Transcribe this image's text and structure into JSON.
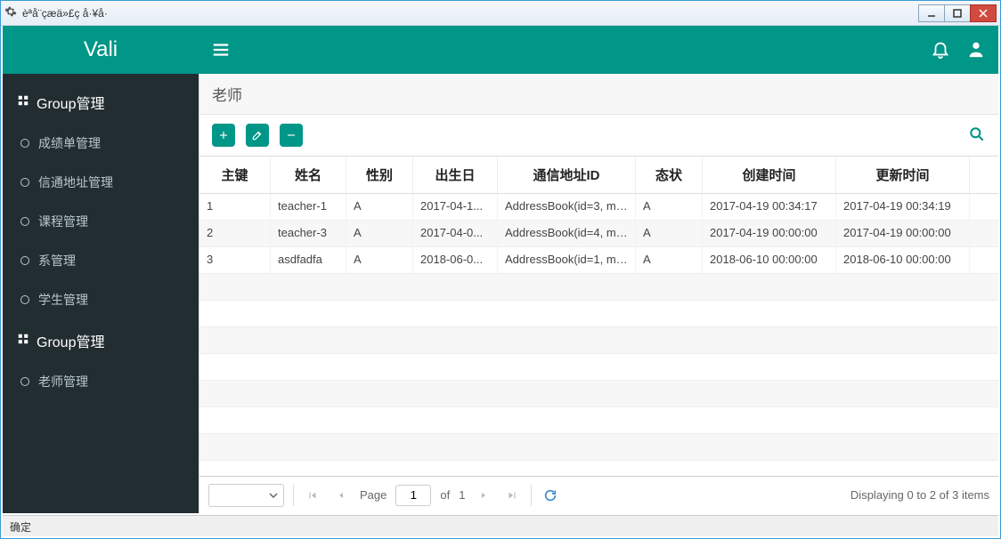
{
  "window": {
    "title": "èªå¨çæä»£ç å·¥å·",
    "status": "确定"
  },
  "brand": "Vali",
  "sidebar": {
    "groups": [
      {
        "label": "Group管理",
        "items": [
          {
            "label": "成绩单管理"
          },
          {
            "label": "信通地址管理"
          },
          {
            "label": "课程管理"
          },
          {
            "label": "系管理"
          },
          {
            "label": "学生管理"
          }
        ]
      },
      {
        "label": "Group管理",
        "items": [
          {
            "label": "老师管理"
          }
        ]
      }
    ]
  },
  "page": {
    "title": "老师"
  },
  "table": {
    "columns": [
      "主键",
      "姓名",
      "性别",
      "出生日",
      "通信地址ID",
      "态状",
      "创建时间",
      "更新时间"
    ],
    "rows": [
      {
        "id": "1",
        "name": "teacher-1",
        "sex": "A",
        "birth": "2017-04-1...",
        "addr": "AddressBook(id=3, mo...",
        "status": "A",
        "created": "2017-04-19 00:34:17",
        "updated": "2017-04-19 00:34:19"
      },
      {
        "id": "2",
        "name": "teacher-3",
        "sex": "A",
        "birth": "2017-04-0...",
        "addr": "AddressBook(id=4, mo...",
        "status": "A",
        "created": "2017-04-19 00:00:00",
        "updated": "2017-04-19 00:00:00"
      },
      {
        "id": "3",
        "name": "asdfadfa",
        "sex": "A",
        "birth": "2018-06-0...",
        "addr": "AddressBook(id=1, mo...",
        "status": "A",
        "created": "2018-06-10 00:00:00",
        "updated": "2018-06-10 00:00:00"
      }
    ]
  },
  "pager": {
    "page_label": "Page",
    "page": "1",
    "of_label": "of",
    "total_pages": "1",
    "summary": "Displaying 0 to 2 of 3 items"
  }
}
